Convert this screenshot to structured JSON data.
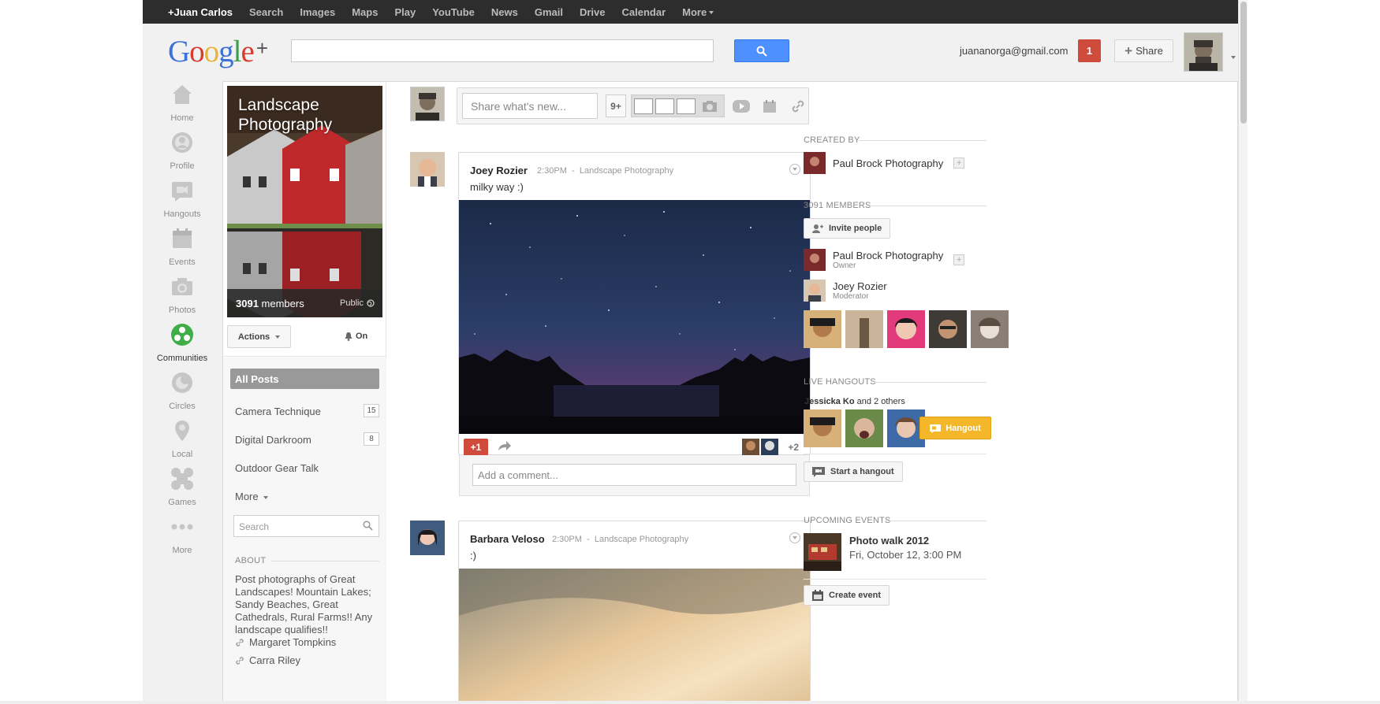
{
  "topbar": {
    "items": [
      "+Juan Carlos",
      "Search",
      "Images",
      "Maps",
      "Play",
      "YouTube",
      "News",
      "Gmail",
      "Drive",
      "Calendar",
      "More"
    ]
  },
  "header": {
    "logo": "Google",
    "logo_plus": "+",
    "search_placeholder": "",
    "email": "juananorga@gmail.com",
    "notification_count": "1",
    "share_label": "Share"
  },
  "rail": {
    "items": [
      {
        "label": "Home",
        "icon": "home-icon"
      },
      {
        "label": "Profile",
        "icon": "profile-icon"
      },
      {
        "label": "Hangouts",
        "icon": "hangouts-icon"
      },
      {
        "label": "Events",
        "icon": "events-icon"
      },
      {
        "label": "Photos",
        "icon": "photos-icon"
      },
      {
        "label": "Communities",
        "icon": "communities-icon"
      },
      {
        "label": "Circles",
        "icon": "circles-icon"
      },
      {
        "label": "Local",
        "icon": "local-icon"
      },
      {
        "label": "Games",
        "icon": "games-icon"
      },
      {
        "label": "More",
        "icon": "more-dots-icon"
      }
    ]
  },
  "community": {
    "title": "Landscape Photography",
    "members_count": "3091",
    "members_label": "members",
    "visibility": "Public",
    "actions_label": "Actions",
    "notify_label": "On",
    "categories": [
      {
        "label": "All Posts",
        "count": ""
      },
      {
        "label": "Camera Technique",
        "count": "15"
      },
      {
        "label": "Digital Darkroom",
        "count": "8"
      },
      {
        "label": "Outdoor Gear Talk",
        "count": ""
      },
      {
        "label": "More",
        "count": ""
      }
    ],
    "search_placeholder": "Search",
    "about_heading": "ABOUT",
    "about_text": "Post photographs of Great Landscapes!  Mountain Lakes; Sandy Beaches, Great Cathedrals, Rural Farms!!  Any landscape qualifies!!",
    "links": [
      "Margaret Tompkins",
      "Carra Riley"
    ]
  },
  "sharebox": {
    "placeholder": "Share what's new...",
    "count_badge": "9+"
  },
  "posts": [
    {
      "author": "Joey Rozier",
      "time": "2:30PM",
      "separator": "-",
      "community": "Landscape Photography",
      "text": "milky way :)",
      "plus_one": "+1",
      "plus_more": "+2",
      "comment_placeholder": "Add a comment..."
    },
    {
      "author": "Barbara Veloso",
      "time": "2:30PM",
      "separator": "-",
      "community": "Landscape Photography",
      "text": ":)"
    }
  ],
  "sidebar": {
    "created_by_heading": "CREATED BY",
    "creator": "Paul Brock Photography",
    "members_heading": "3091 MEMBERS",
    "invite_label": "Invite people",
    "owner": {
      "name": "Paul Brock Photography",
      "role": "Owner"
    },
    "moderator": {
      "name": "Joey Rozier",
      "role": "Moderator"
    },
    "live_heading": "LIVE HANGOUTS",
    "hangout_host": "Jessicka Ko",
    "hangout_others": "and 2 others",
    "hangout_btn": "Hangout",
    "start_hangout": "Start a hangout",
    "events_heading": "UPCOMING EVENTS",
    "event_title": "Photo walk 2012",
    "event_date": "Fri, October 12, 3:00 PM",
    "create_event": "Create event"
  },
  "colors": {
    "topbar_bg": "#2d2d2d",
    "accent_blue": "#4d90fe",
    "notif_red": "#cf4b3b",
    "hangout_yellow": "#f5b72a",
    "communities_green": "#3fae49"
  }
}
